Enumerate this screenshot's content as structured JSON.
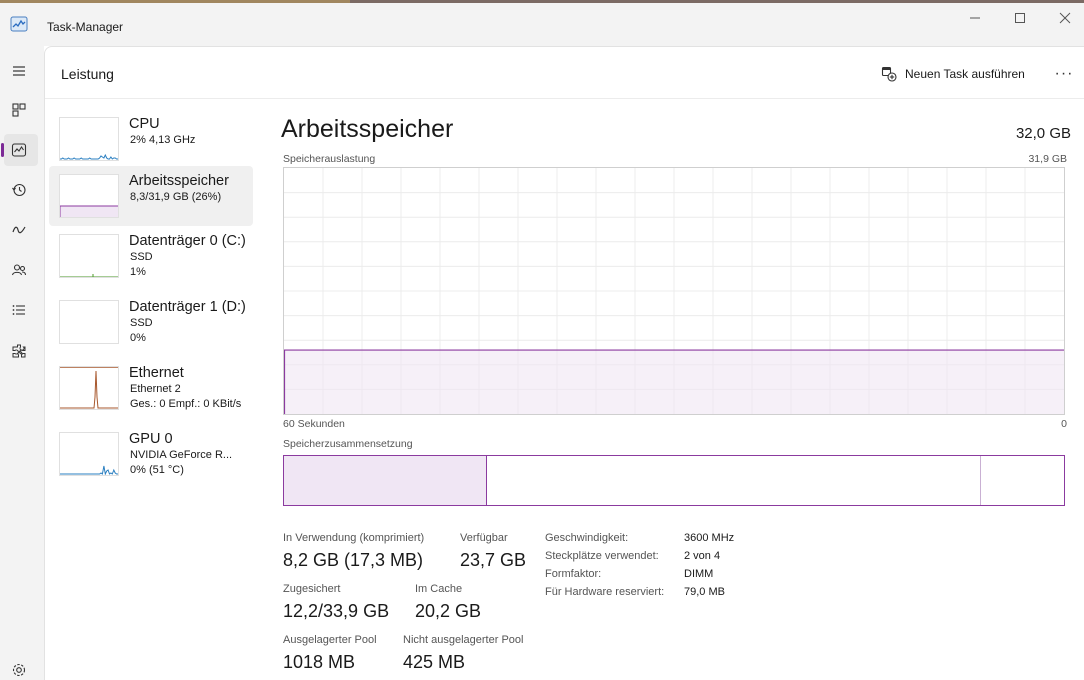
{
  "window": {
    "title": "Task-Manager"
  },
  "header": {
    "page_title": "Leistung",
    "run_task_label": "Neuen Task ausführen",
    "more_label": "···"
  },
  "devices": [
    {
      "name": "CPU",
      "line1": "2% 4,13 GHz",
      "line2": ""
    },
    {
      "name": "Arbeitsspeicher",
      "line1": "8,3/31,9 GB (26%)",
      "line2": ""
    },
    {
      "name": "Datenträger 0 (C:)",
      "line1": "SSD",
      "line2": "1%"
    },
    {
      "name": "Datenträger 1 (D:)",
      "line1": "SSD",
      "line2": "0%"
    },
    {
      "name": "Ethernet",
      "line1": "Ethernet 2",
      "line2": "Ges.: 0 Empf.: 0 KBit/s"
    },
    {
      "name": "GPU 0",
      "line1": "NVIDIA GeForce R...",
      "line2": "0% (51 °C)"
    }
  ],
  "memory": {
    "title": "Arbeitsspeicher",
    "total": "32,0 GB",
    "usage_label": "Speicherauslastung",
    "usage_max": "31,9 GB",
    "usage_fraction": 0.26,
    "time_left": "60 Sekunden",
    "time_right": "0",
    "composition_label": "Speicherzusammensetzung",
    "composition_used_fraction": 0.26,
    "composition_standby_fraction": 0.633
  },
  "stats": {
    "in_use_label": "In Verwendung (komprimiert)",
    "in_use_value": "8,2 GB (17,3 MB)",
    "available_label": "Verfügbar",
    "available_value": "23,7 GB",
    "committed_label": "Zugesichert",
    "committed_value": "12,2/33,9 GB",
    "cached_label": "Im Cache",
    "cached_value": "20,2 GB",
    "paged_label": "Ausgelagerter Pool",
    "paged_value": "1018 MB",
    "nonpaged_label": "Nicht ausgelagerter Pool",
    "nonpaged_value": "425 MB"
  },
  "specs": [
    {
      "key": "Geschwindigkeit:",
      "value": "3600 MHz"
    },
    {
      "key": "Steckplätze verwendet:",
      "value": "2 von 4"
    },
    {
      "key": "Formfaktor:",
      "value": "DIMM"
    },
    {
      "key": "Für Hardware reserviert:",
      "value": "79,0 MB"
    }
  ],
  "colors": {
    "accent": "#7c2a96",
    "memory_line": "#8b3a9f",
    "memory_fill": "#f0e6f4",
    "cpu_line": "#2a7fc1",
    "disk_line": "#4d9a2a",
    "ethernet_line": "#a7572c",
    "gpu_line": "#2a7fc1"
  },
  "icons": {
    "app": "task-manager-graph-icon",
    "nav": [
      "hamburger-icon",
      "processes-icon",
      "performance-icon",
      "app-history-icon",
      "startup-apps-icon",
      "users-icon",
      "details-icon",
      "services-icon",
      "settings-icon"
    ]
  }
}
